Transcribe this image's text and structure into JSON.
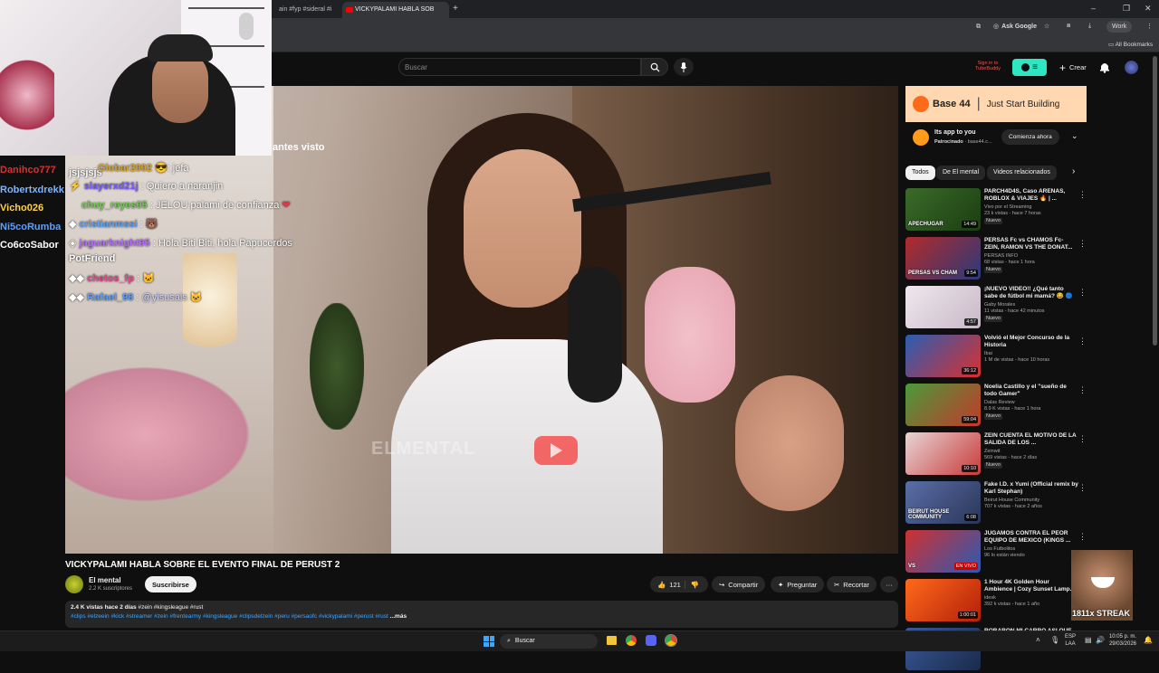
{
  "browser": {
    "tabs": [
      {
        "label": "ain #fyp #sideral #i"
      },
      {
        "label": "VICKYPALAMI HABLA SOB"
      }
    ],
    "ask_google": "Ask Google",
    "all_bookmarks": "All Bookmarks",
    "profile": "Work"
  },
  "youtube": {
    "search_placeholder": "Buscar",
    "signin_promo": "Sign in to TubeBuddy",
    "create_label": "Crear"
  },
  "stream": {
    "overlay_text": "antes visto",
    "watermark": "ELMENTAL",
    "left_names": [
      {
        "name": "Danihco777",
        "color": "#d9302f"
      },
      {
        "name": "Robertxdrekk",
        "color": "#7fb3ff"
      },
      {
        "name": "Vicho026",
        "color": "#ffd24d"
      },
      {
        "name": "Ni5coRumba",
        "color": "#5aa0ff"
      },
      {
        "name": "Co6coSabor",
        "color": "#ffffff"
      }
    ],
    "chat": [
      {
        "user": "",
        "text": "jsjsjsjs"
      },
      {
        "user": "Globar2002",
        "text": ": jefa",
        "color": "#d4a32e"
      },
      {
        "user": "slayerxd21j",
        "text": ": Quiero a naranjin",
        "color": "#7a5cff"
      },
      {
        "user": "chuy_reyes05",
        "text": ": JELOU palami de confianza",
        "color": "#6ccf4a"
      },
      {
        "user": "cristianmssi",
        "text": ":",
        "color": "#5aa0ff"
      },
      {
        "user": "jaguarknight95",
        "text": ": Hola Biti Biti, hola Papucerdos",
        "color": "#b46cff"
      },
      {
        "user": "",
        "text": "PotFriend"
      },
      {
        "user": "chetos_fp",
        "text": ":",
        "color": "#e84a8f"
      },
      {
        "user": "Rafael_98",
        "text": ":",
        "color": "#5aa0ff"
      }
    ],
    "mention": "@yisusais"
  },
  "video": {
    "title": "VICKYPALAMI HABLA SOBRE EL EVENTO FINAL DE PERUST 2",
    "channel": "El mental",
    "subscribers": "2.2 K suscriptores",
    "subscribe": "Suscribirse",
    "likes": "121",
    "share": "Compartir",
    "ask": "Preguntar",
    "clip": "Recortar",
    "views_time": "2.4 K vistas  hace 2 días",
    "tags_line": "#zein #kingsleague #rust",
    "hashtags": "#clips #elzeein #kick #streamer #zein #frentearmy #kingsleague #clipsdelzein #peru #persaofc #vickypalami #perust #rust",
    "more": "...más"
  },
  "ad": {
    "brand": "Base 44",
    "slogan": "Just Start Building",
    "headline": "Its app to you",
    "sponsored": "Patrocinado",
    "domain": "base44.c...",
    "cta": "Comienza ahora"
  },
  "chips": [
    "Todos",
    "De El mental",
    "Videos relacionados"
  ],
  "recommendations": [
    {
      "title": "PARCH4D4S, Caso ARENAS, ROBLOX & VIAJES 🔥 | ...",
      "channel": "Vivo por el Streaming",
      "meta": "23 k vistas - hace 7 horas",
      "badge": "Nuevo",
      "duration": "14:49",
      "thumb_text": "APECHUGAR",
      "c1": "#3a6b2a",
      "c2": "#1c3d12"
    },
    {
      "title": "PERSAS Fc vs CHAMOS Fc- ZEIN, RAMON VS THE DONAT...",
      "channel": "PERSAS INFO",
      "meta": "68 vistas - hace 1 hora",
      "badge": "Nuevo",
      "duration": "9:54",
      "thumb_text": "PERSAS VS CHAM",
      "c1": "#b32a2a",
      "c2": "#2a3a7a"
    },
    {
      "title": "¡NUEVO VIDEO!! ¿Qué tanto sabe de fútbol mi mamá? 😂 🔵",
      "channel": "Gaby Morales",
      "meta": "11 vistas - hace 42 minutos",
      "badge": "Nuevo",
      "duration": "4:57",
      "thumb_text": "",
      "c1": "#efe8ee",
      "c2": "#c8b8c6"
    },
    {
      "title": "Volvió el Mejor Concurso de la Historia",
      "channel": "Ibai",
      "meta": "1 M de vistas - hace 10 horas",
      "badge": "",
      "duration": "36:12",
      "thumb_text": "",
      "c1": "#2a5db3",
      "c2": "#d93030"
    },
    {
      "title": "Noelia Castillo y el \"sueño de todo Gamer\"",
      "channel": "Dalas Review",
      "meta": "8.9 K vistas - hace 1 hora",
      "badge": "Nuevo",
      "duration": "59:04",
      "thumb_text": "",
      "c1": "#4a9a3a",
      "c2": "#c23a2a"
    },
    {
      "title": "ZEIN CUENTA EL MOTIVO DE LA SALIDA DE LOS ...",
      "channel": "Zeinwit",
      "meta": "569 vistas - hace 2 días",
      "badge": "Nuevo",
      "duration": "10:10",
      "thumb_text": "",
      "c1": "#e8d5d5",
      "c2": "#c93a3a"
    },
    {
      "title": "Fake I.D. x Yumi (Official remix by Karl Stephan)",
      "channel": "Beirut House Community",
      "meta": "707 k vistas - hace 2 años",
      "badge": "",
      "duration": "6:08",
      "thumb_text": "BEIRUT HOUSE COMMUNITY",
      "c1": "#5a6fa8",
      "c2": "#2a3558"
    },
    {
      "title": "JUGAMOS CONTRA EL PEOR EQUIPO DE MEXICO (KINGS ...",
      "channel": "Los Futbolitos",
      "meta": "96 lo están viendo",
      "badge": "",
      "duration": "EN VIVO",
      "thumb_text": "VS",
      "c1": "#d03030",
      "c2": "#2a5ab3"
    },
    {
      "title": "1 Hour 4K Golden Hour Ambience | Cozy Sunset Lamp...",
      "channel": "idesk",
      "meta": "392 k vistas - hace 1 año",
      "badge": "",
      "duration": "1:00:01",
      "thumb_text": "",
      "c1": "#ff6a1a",
      "c2": "#b3200a"
    },
    {
      "title": "ROBARON MI CARRO ASI QUE",
      "channel": "",
      "meta": "",
      "badge": "",
      "duration": "",
      "thumb_text": "",
      "c1": "#3a5a9a",
      "c2": "#1a2a4a"
    }
  ],
  "streak": "1811x STREAK",
  "taskbar": {
    "search": "Buscar",
    "lang": "ESP",
    "lang2": "LAA",
    "time": "10:05 p. m.",
    "date": "29/03/2026"
  }
}
